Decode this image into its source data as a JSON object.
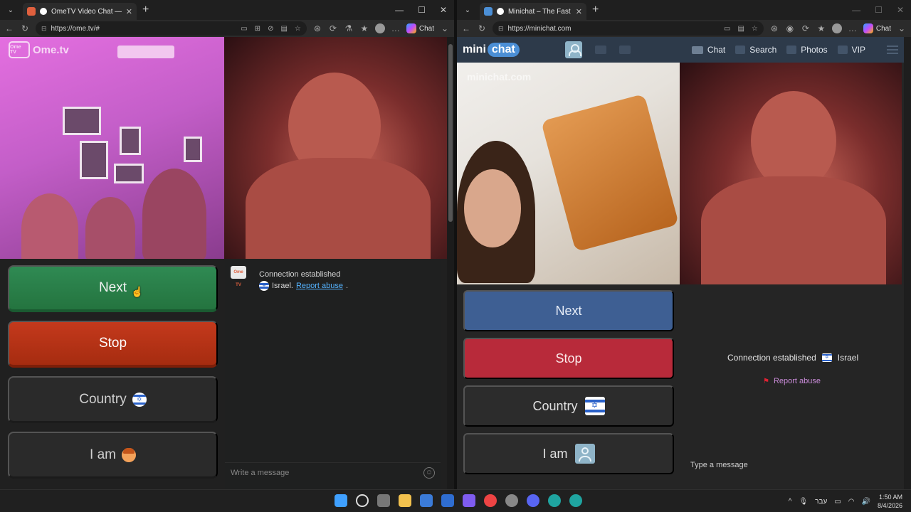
{
  "left_window": {
    "tab_title": "OmeTV Video Chat — Omegl",
    "url": "https://ome.tv/#",
    "copilot_label": "Chat",
    "site": {
      "logo_text": "Ome.tv",
      "logo_badge": "Ome TV",
      "buttons": {
        "next": "Next",
        "stop": "Stop",
        "country": "Country",
        "iam": "I am"
      },
      "chat": {
        "avatar_text": "Ome TV",
        "status": "Connection established",
        "country": "Israel.",
        "report": "Report abuse",
        "report_suffix": ".",
        "input_placeholder": "Write a message"
      }
    }
  },
  "right_window": {
    "tab_title": "Minichat – The Fast Video Chat",
    "url": "https://minichat.com",
    "copilot_label": "Chat",
    "site": {
      "logo_mini": "mini",
      "logo_chat": "chat",
      "watermark": "minichat.com",
      "menu": {
        "chat": "Chat",
        "search": "Search",
        "photos": "Photos",
        "vip": "VIP"
      },
      "buttons": {
        "next": "Next",
        "stop": "Stop",
        "country": "Country",
        "iam": "I am"
      },
      "status": "Connection established",
      "status_country": "Israel",
      "report": "Report abuse",
      "type_placeholder": "Type a message"
    }
  },
  "taskbar": {
    "language": "עבר",
    "time": "1:50 AM",
    "date": "8/4/2026"
  },
  "colors": {
    "ome_next": "#2f8a53",
    "ome_stop": "#c4391c",
    "mc_next": "#3e5f93",
    "mc_stop": "#b82a3a",
    "link": "#55b3ff"
  }
}
